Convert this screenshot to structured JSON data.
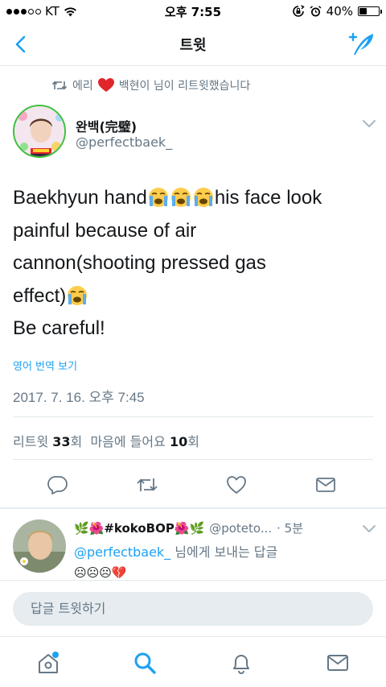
{
  "status_bar": {
    "carrier": "KT",
    "time": "오후 7:55",
    "battery_percent": "40%",
    "battery_level": 0.4
  },
  "nav": {
    "title": "트윗",
    "back_icon": "chevron-left-icon",
    "compose_icon": "compose-tweet-icon"
  },
  "retweet_context": {
    "prefix": "에리",
    "emoji": "❤️",
    "suffix": "백현이 님이 리트윗했습니다"
  },
  "tweet": {
    "author_name": "완백(完璧)",
    "author_handle": "@perfectbaek_",
    "text": {
      "line1_start": "Baekhyun hand",
      "line1_end": "his face look",
      "line2": "painful because of air",
      "line3": "cannon(shooting pressed gas",
      "line4_start": "effect)",
      "line5": "Be careful!"
    },
    "translate_label": "영어 번역 보기",
    "timestamp": "2017. 7. 16. 오후 7:45",
    "stats": {
      "retweets_label": "리트윗",
      "retweets_count": "33",
      "retweets_unit": "회",
      "likes_label": "마음에 들어요",
      "likes_count": "10",
      "likes_unit": "회"
    }
  },
  "reply": {
    "display_name": "🌿🌺#kokoBOP🌺🌿",
    "handle": "@poteto...",
    "time": "· 5분",
    "reply_to_mention": "@perfectbaek_",
    "reply_to_suffix": " 님에게 보내는 답글",
    "text": "☹☹☹💔"
  },
  "reply_box": {
    "placeholder": "답글 트윗하기"
  },
  "colors": {
    "accent": "#1da1f2",
    "secondary_text": "#657786",
    "border": "#e1e8ed"
  }
}
